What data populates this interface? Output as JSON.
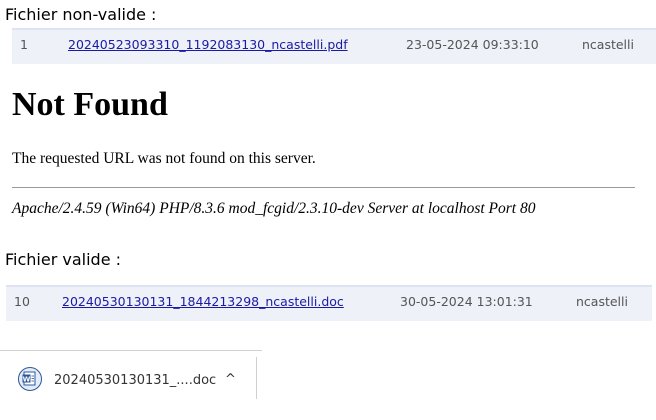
{
  "invalid_section": {
    "label": "Fichier non-valide :",
    "row": {
      "index": "1",
      "filename": "20240523093310_1192083130_ncastelli.pdf",
      "date": "23-05-2024 09:33:10",
      "user": "ncastelli"
    }
  },
  "not_found_page": {
    "title": "Not Found",
    "message": "The requested URL was not found on this server.",
    "server_signature": "Apache/2.4.59 (Win64) PHP/8.3.6 mod_fcgid/2.3.10-dev Server at localhost Port 80"
  },
  "valid_section": {
    "label": "Fichier valide :",
    "row": {
      "index": "10",
      "filename": "20240530130131_1844213298_ncastelli.doc",
      "date": "30-05-2024 13:01:31",
      "user": "ncastelli"
    }
  },
  "download_bar": {
    "item_label": "20240530130131_....doc",
    "file_icon": "word-document-icon",
    "chevron_glyph": "^",
    "chevron_icon": "chevron-up-icon"
  },
  "colors": {
    "link": "#1a1aa6",
    "row_background": "#eef1f8",
    "word_blue": "#2b579a"
  }
}
